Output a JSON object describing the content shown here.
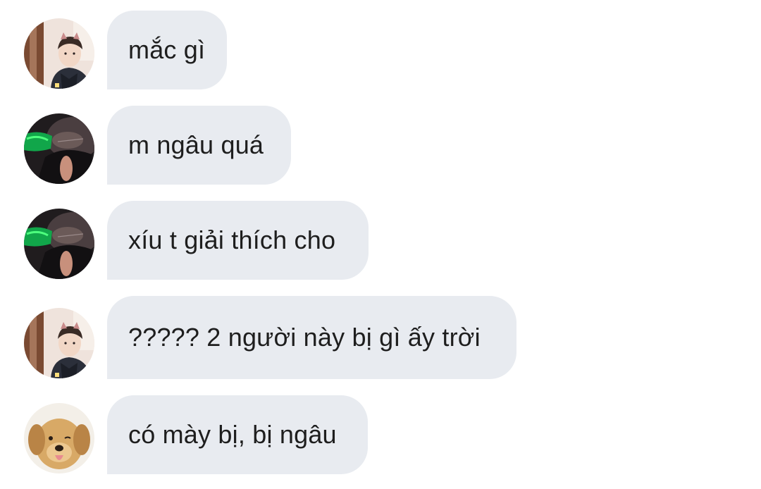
{
  "messages": [
    {
      "sender_avatar": "avatar-boy-cat-ears",
      "text": "mắc gì"
    },
    {
      "sender_avatar": "avatar-dark-green-light",
      "text": "m ngâu quá"
    },
    {
      "sender_avatar": "avatar-dark-green-light",
      "text": "xíu t giải thích cho"
    },
    {
      "sender_avatar": "avatar-boy-cat-ears",
      "text": "????? 2 người này bị gì ấy trời"
    },
    {
      "sender_avatar": "avatar-golden-retriever",
      "text": "có mày bị, bị ngâu"
    }
  ],
  "colors": {
    "bubble_background": "#e8ebf0",
    "text": "#1e1e1e",
    "page_background": "#ffffff"
  }
}
